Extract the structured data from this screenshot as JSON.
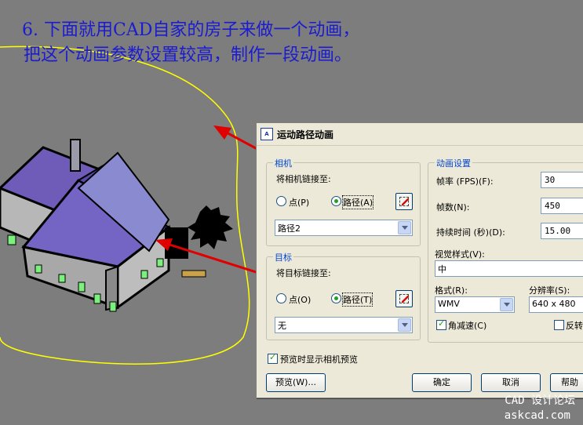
{
  "caption": {
    "line1": "6. 下面就用CAD自家的房子来做一个动画，",
    "line2": "把这个动画参数设置较高，制作一段动画。"
  },
  "watermark": {
    "line1": "CAD 设计论坛",
    "line2": "askcad.com"
  },
  "dialog": {
    "title": "运动路径动画",
    "camera": {
      "group_label": "相机",
      "link_label": "将相机链接至:",
      "point_label": "点(P)",
      "path_label": "路径(A)",
      "selected": "path",
      "path_value": "路径2"
    },
    "target": {
      "group_label": "目标",
      "link_label": "将目标链接至:",
      "point_label": "点(O)",
      "path_label": "路径(T)",
      "selected": "path",
      "path_value": "无"
    },
    "preview_checkbox": {
      "label": "预览时显示相机预览",
      "checked": true
    },
    "anim": {
      "group_label": "动画设置",
      "fps_label": "帧率 (FPS)(F):",
      "fps_value": "30",
      "frames_label": "帧数(N):",
      "frames_value": "450",
      "duration_label": "持续时间 (秒)(D):",
      "duration_value": "15.00",
      "visual_style_label": "视觉样式(V):",
      "visual_style_value": "中",
      "format_label": "格式(R):",
      "format_value": "WMV",
      "resolution_label": "分辨率(S):",
      "resolution_value": "640 x 480",
      "decel_label": "角减速(C)",
      "decel_checked": true,
      "reverse_label": "反转",
      "reverse_checked": false
    },
    "buttons": {
      "preview": "预览(W)...",
      "ok": "确定",
      "cancel": "取消",
      "help": "帮助"
    }
  },
  "colors": {
    "caption": "#1b1bd0",
    "viewport_bg": "#7d7d7d",
    "motion_path": "#ffff00",
    "arrow": "#e00000",
    "roof": "#6a5ab4",
    "wall": "#b4b4b4",
    "window": "#7cf07c"
  }
}
